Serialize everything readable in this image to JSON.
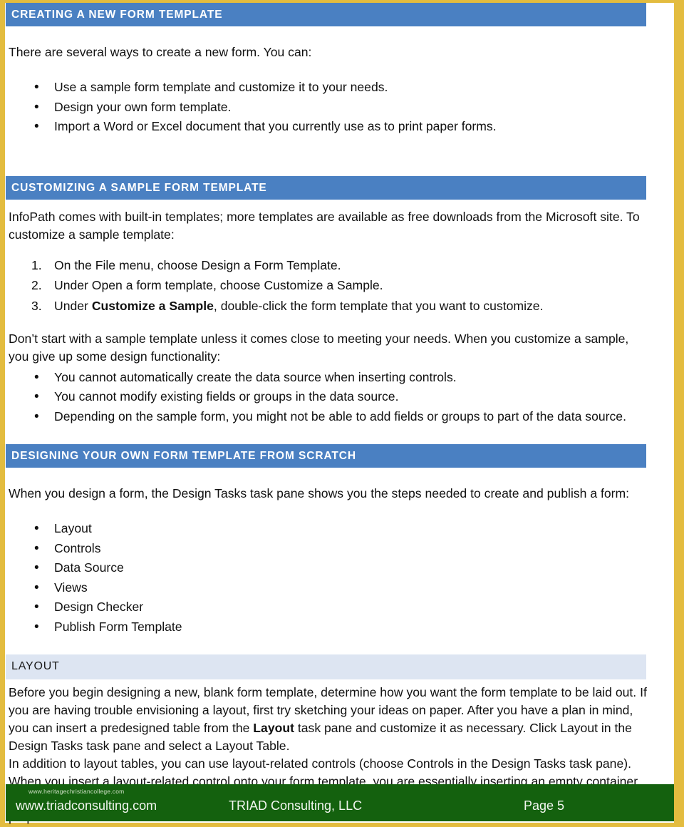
{
  "document": {
    "title": "Creating a New Form Template",
    "accent_blue": "#4a80c2",
    "accent_lightblue": "#dde5f2",
    "accent_gold": "#e3bc3f",
    "accent_green": "#14610e"
  },
  "sections": {
    "creating": {
      "heading": "CREATING A NEW FORM TEMPLATE",
      "intro": "There are several ways to create a new form. You can:",
      "bullets": [
        "Use a sample form template and customize it to your needs.",
        "Design your own form template.",
        "Import a Word or Excel document that you currently use as to print paper forms."
      ]
    },
    "customizing": {
      "heading": "CUSTOMIZING A SAMPLE FORM TEMPLATE",
      "intro": "InfoPath comes with built-in templates; more templates are available as free downloads from the Microsoft site. To customize a sample template:",
      "steps": [
        {
          "pre": "On the File menu, choose Design a Form Template.",
          "bold": "",
          "post": ""
        },
        {
          "pre": "Under Open a form template, choose Customize a Sample.",
          "bold": "",
          "post": ""
        },
        {
          "pre": "Under ",
          "bold": "Customize a Sample",
          "post": ", double-click the form template that you want to customize."
        }
      ],
      "warning": "Don’t start with a sample template unless it comes close to meeting your needs. When you customize a sample, you give up some design functionality:",
      "limitations": [
        "You cannot automatically create the data source when inserting controls.",
        "You cannot modify existing fields or groups in the data source.",
        "Depending on the sample form, you might not be able to add fields or groups to part of the data source."
      ]
    },
    "designing": {
      "heading": "DESIGNING YOUR OWN FORM TEMPLATE FROM SCRATCH",
      "intro": "When you design a form, the Design Tasks task pane shows you the steps needed to create and publish a form:",
      "tasks": [
        "Layout",
        "Controls",
        "Data Source",
        "Views",
        "Design Checker",
        "Publish Form Template"
      ]
    },
    "layout": {
      "heading": "LAYOUT",
      "para1_pre": "Before you begin designing a new, blank form template, determine how you want the form template to be laid out. If you are having trouble envisioning a layout, first try sketching your ideas on paper. After you have a plan in mind, you can insert a predesigned table from the ",
      "para1_bold": "Layout",
      "para1_post": " task pane and customize it as necessary. Click Layout in the Design Tasks task pane and select a Layout Table.",
      "para2": "In addition to layout tables, you can use layout-related controls (choose Controls in the Design Tasks task pane). When you insert a layout-related control onto your form template, you are essentially inserting an empty container for storing other controls. The following table describes the controls that are most commonly used for layout purposes."
    }
  },
  "footer": {
    "watermark": "www.heritagechristiancollege.com",
    "left": "www.triadconsulting.com",
    "center": "TRIAD Consulting, LLC",
    "right": "Page 5"
  }
}
